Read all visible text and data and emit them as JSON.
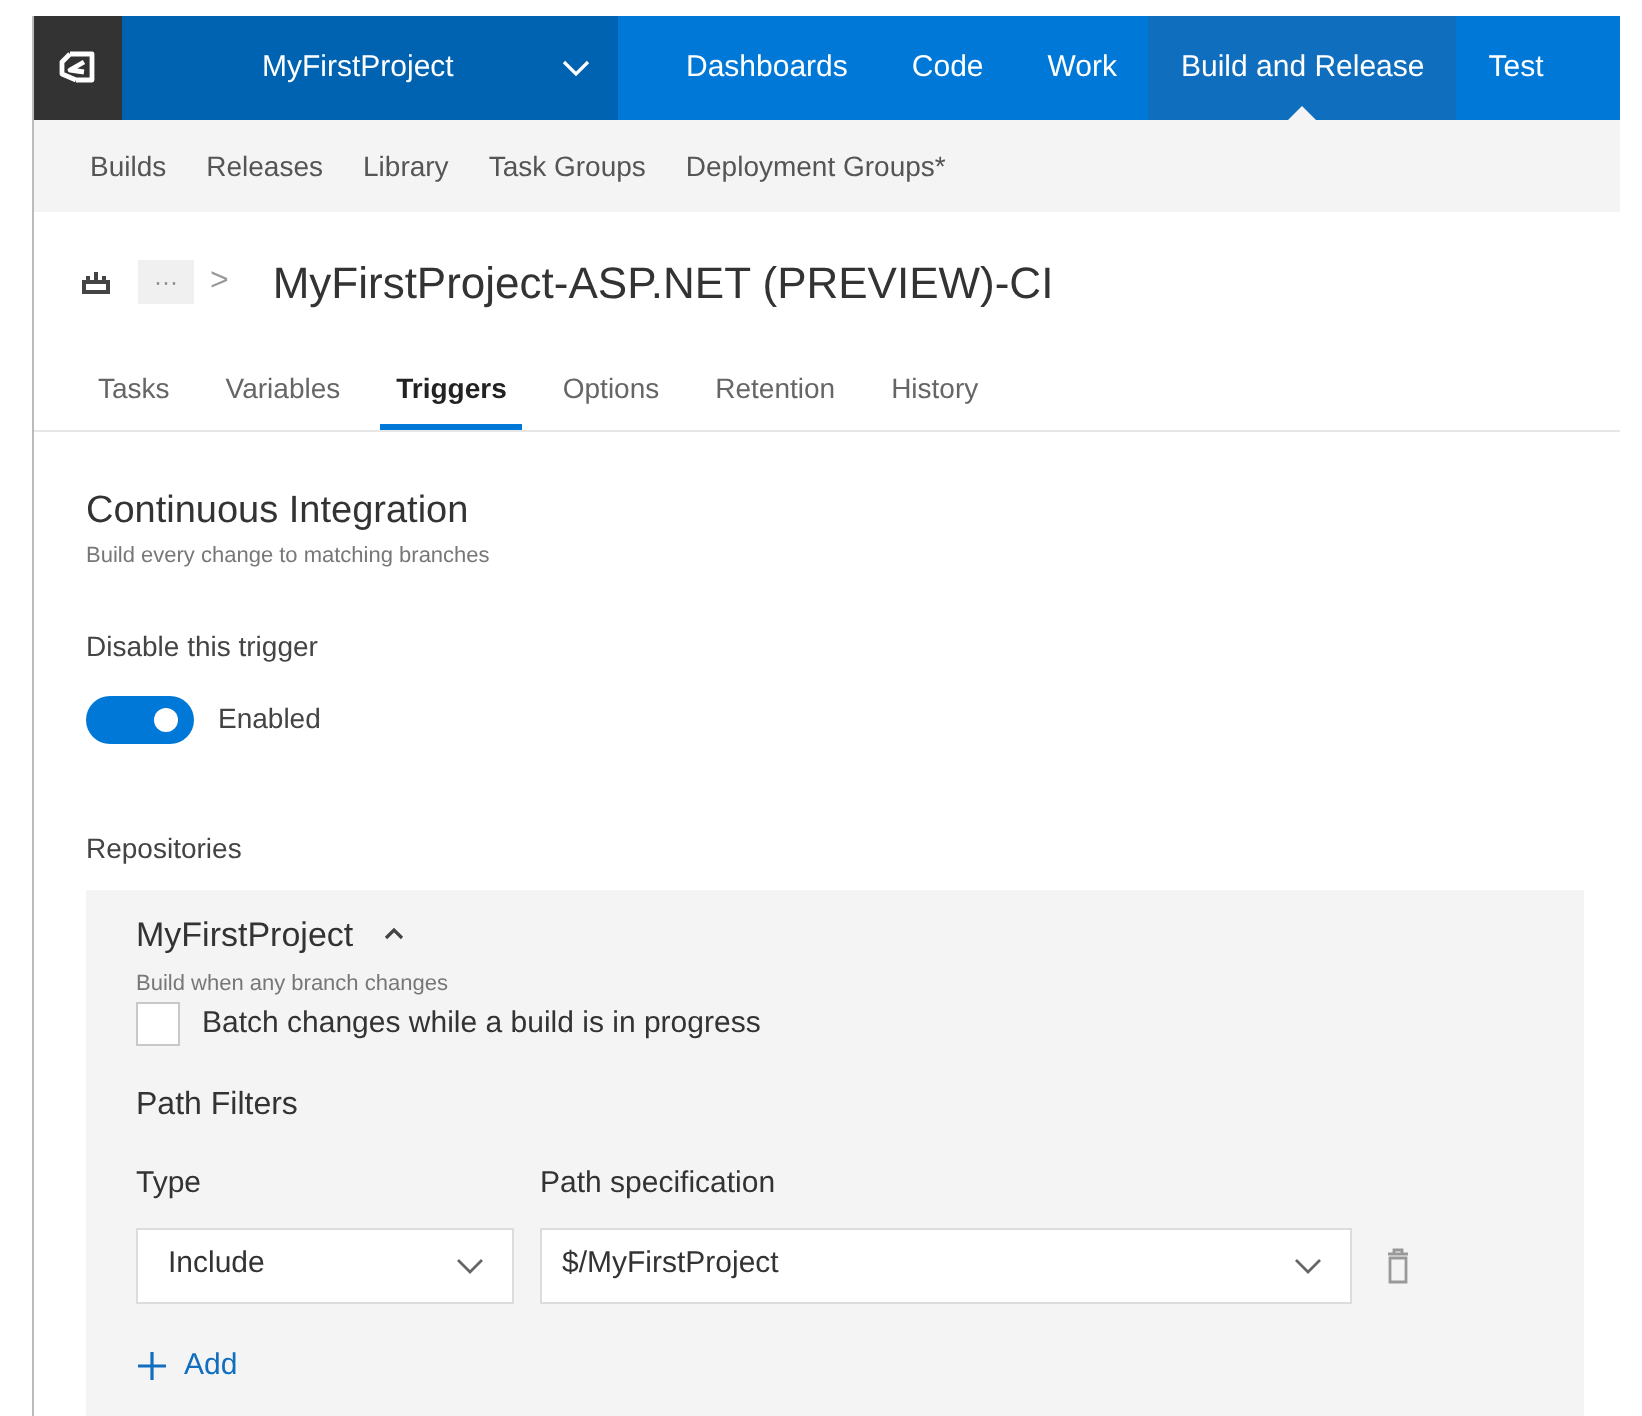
{
  "project_menu": {
    "label": "MyFirstProject"
  },
  "nav": [
    {
      "label": "Dashboards",
      "selected": false
    },
    {
      "label": "Code",
      "selected": false
    },
    {
      "label": "Work",
      "selected": false
    },
    {
      "label": "Build and Release",
      "selected": true
    },
    {
      "label": "Test",
      "selected": false
    }
  ],
  "subnav": [
    "Builds",
    "Releases",
    "Library",
    "Task Groups",
    "Deployment Groups*"
  ],
  "breadcrumb": {
    "more": "···",
    "separator": ">",
    "title": "MyFirstProject-ASP.NET (PREVIEW)-CI"
  },
  "tabs": [
    {
      "label": "Tasks",
      "selected": false
    },
    {
      "label": "Variables",
      "selected": false
    },
    {
      "label": "Triggers",
      "selected": true
    },
    {
      "label": "Options",
      "selected": false
    },
    {
      "label": "Retention",
      "selected": false
    },
    {
      "label": "History",
      "selected": false
    }
  ],
  "section": {
    "title": "Continuous Integration",
    "subtitle": "Build every change to matching branches"
  },
  "trigger": {
    "label": "Disable this trigger",
    "on": true,
    "state_text": "Enabled"
  },
  "repositories": {
    "label": "Repositories",
    "repo": {
      "name": "MyFirstProject",
      "expanded": true,
      "description": "Build when any branch changes",
      "batch": {
        "label": "Batch changes while a build is in progress",
        "checked": false
      },
      "path_filters": {
        "title": "Path Filters",
        "type_label": "Type",
        "path_label": "Path specification",
        "rows": [
          {
            "type": "Include",
            "path": "$/MyFirstProject"
          }
        ],
        "add": "Add"
      }
    }
  }
}
